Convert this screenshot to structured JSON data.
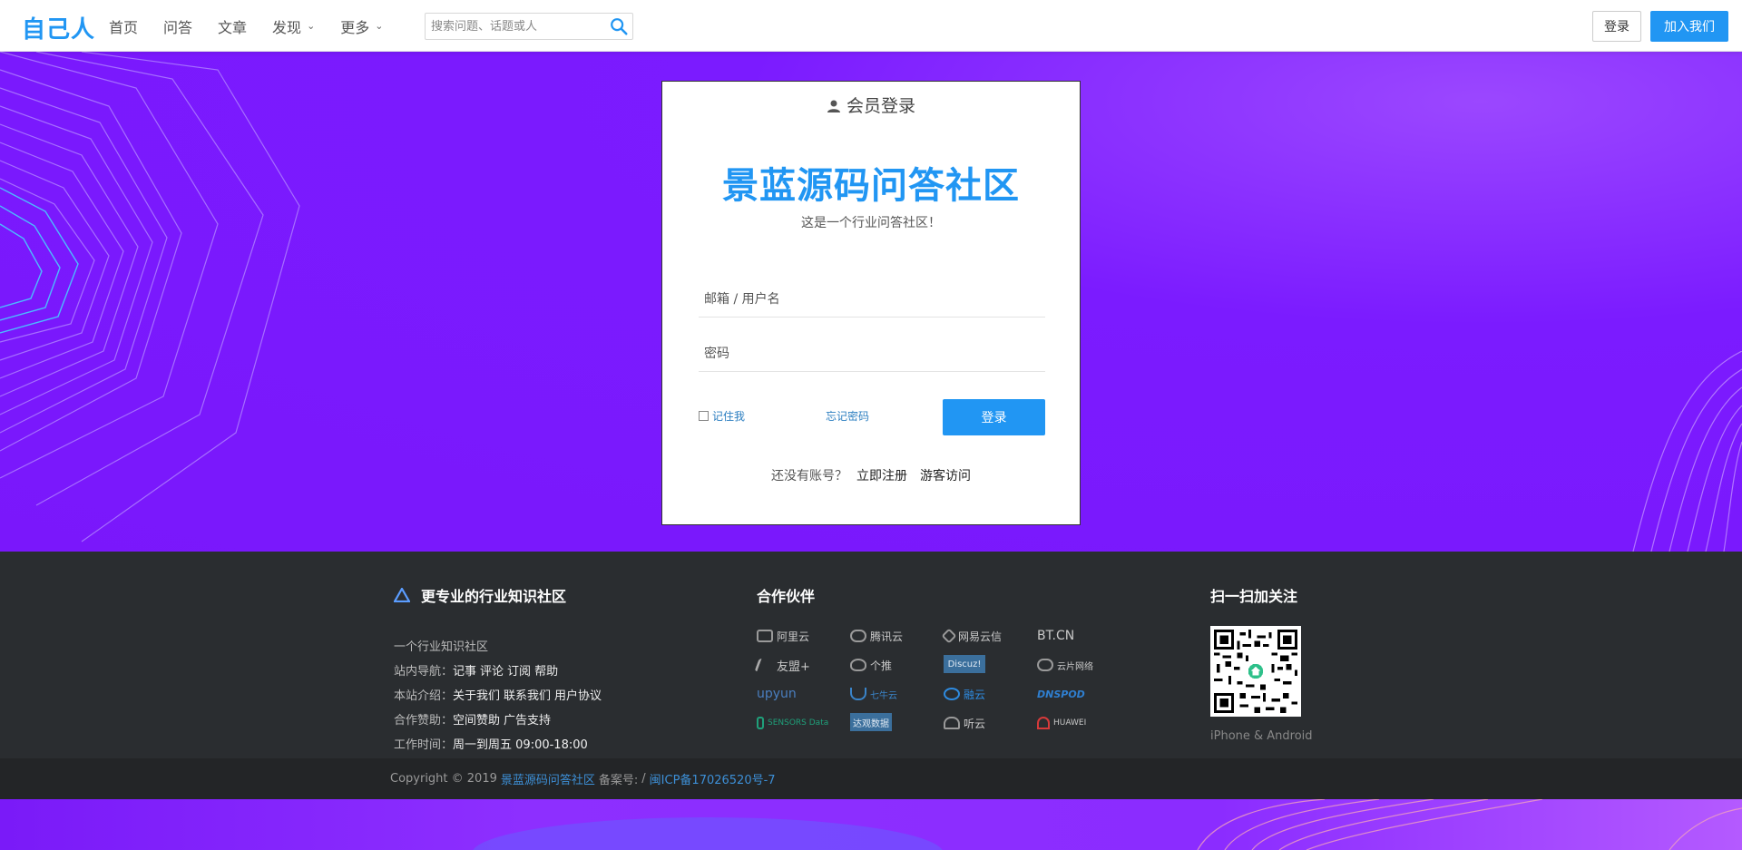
{
  "header": {
    "logo": "自己人",
    "nav": [
      {
        "label": "首页",
        "has_dropdown": false
      },
      {
        "label": "问答",
        "has_dropdown": false
      },
      {
        "label": "文章",
        "has_dropdown": false
      },
      {
        "label": "发现",
        "has_dropdown": true
      },
      {
        "label": "更多",
        "has_dropdown": true
      }
    ],
    "search_placeholder": "搜索问题、话题或人",
    "login_label": "登录",
    "join_label": "加入我们"
  },
  "login_card": {
    "heading": "会员登录",
    "title": "景蓝源码问答社区",
    "subtitle": "这是一个行业问答社区！",
    "username_placeholder": "邮箱 / 用户名",
    "password_placeholder": "密码",
    "remember_label": "记住我",
    "forgot_label": "忘记密码",
    "submit_label": "登录",
    "no_account_text": "还没有账号？",
    "register_label": "立即注册",
    "guest_label": "游客访问"
  },
  "footer": {
    "about": {
      "heading": "更专业的行业知识社区",
      "subtitle": "一个行业知识社区",
      "rows": [
        {
          "key": "站内导航：",
          "links": [
            "记事",
            "评论",
            "订阅",
            "帮助"
          ]
        },
        {
          "key": "本站介绍：",
          "links": [
            "关于我们",
            "联系我们",
            "用户协议"
          ]
        },
        {
          "key": "合作赞助：",
          "links": [
            "空间赞助",
            "广告支持"
          ]
        },
        {
          "key": "工作时间：",
          "links": [
            "周一到周五 09:00-18:00"
          ]
        }
      ]
    },
    "partners": {
      "heading": "合作伙伴",
      "items": [
        "阿里云",
        "腾讯云",
        "网易云信",
        "BT.CN",
        "友盟+",
        "个推",
        "Discuz!",
        "云片网络",
        "upyun",
        "七牛云",
        "融云",
        "DNSPOD",
        "SENSORS Data",
        "达观数据",
        "听云",
        "HUAWEI"
      ]
    },
    "qr": {
      "heading": "扫一扫加关注",
      "caption": "iPhone & Android"
    },
    "copyright": {
      "prefix": "Copyright © 2019",
      "site": "景蓝源码问答社区",
      "record_label": "备案号:",
      "record_sep": "/",
      "record_no": "闽ICP备17026520号-7"
    }
  },
  "colors": {
    "brand_blue": "#2196f3",
    "hero_purple": "#7b1bff",
    "footer_dark": "#2a2d30"
  }
}
